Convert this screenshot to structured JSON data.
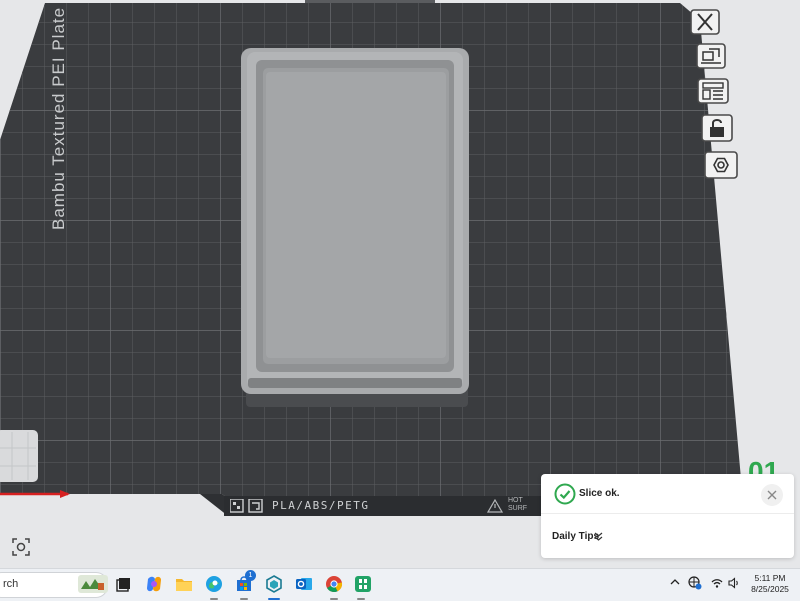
{
  "viewport": {
    "plate_name": "Bambu Textured PEI Plate",
    "plate_number": "01",
    "filament_types": "PLA/ABS/PETG",
    "hot_surface_label": "HOT\nSURF",
    "colors": {
      "plate": "#3d3f42",
      "grid": "#595b5e",
      "part": "#a7a9ab",
      "accent_green": "#2fa84f",
      "x_axis": "#d62020"
    },
    "toolbar_icons": [
      "close-icon",
      "arrange-icon",
      "layout-icon",
      "lock-icon",
      "hexagon-settings-icon"
    ]
  },
  "notification": {
    "status": "Slice ok.",
    "tips_label": "Daily Tips",
    "status_icon": "check-circle-icon",
    "close_icon": "close-icon"
  },
  "taskbar": {
    "search_text": "rch",
    "apps": [
      "widgets-icon",
      "task-view-icon",
      "copilot-icon",
      "file-explorer-icon",
      "edge-icon",
      "store-icon",
      "bambu-studio-icon",
      "outlook-icon",
      "chrome-icon",
      "excel-icon"
    ],
    "store_badge": "1",
    "tray": [
      "chevron-up-icon",
      "network-icon",
      "wifi-icon",
      "volume-icon"
    ],
    "time": "5:11 PM",
    "date": "8/25/2025"
  }
}
